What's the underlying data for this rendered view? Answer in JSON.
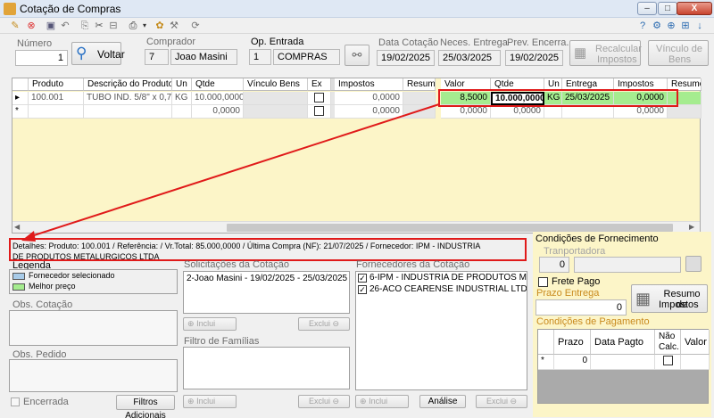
{
  "window": {
    "title": "Cotação de Compras",
    "minimize": "–",
    "maximize": "□",
    "close": "X"
  },
  "inner_controls": [
    "?",
    "⚙",
    "⊕",
    "⊞",
    "↓"
  ],
  "header": {
    "numero_label": "Número",
    "numero_value": "1",
    "voltar_label": "Voltar",
    "comprador_label": "Comprador",
    "comprador_code": "7",
    "comprador_name": "Joao Masini",
    "op_entrada_label": "Op. Entrada",
    "op_entrada_code": "1",
    "op_entrada_name": "COMPRAS",
    "data_cotacao_label": "Data Cotação",
    "data_cotacao_value": "19/02/2025",
    "neces_entrega_label": "Neces. Entrega",
    "neces_entrega_value": "25/03/2025",
    "prev_encerra_label": "Prev. Encerra.",
    "prev_encerra_value": "19/02/2025",
    "recalcular_label_1": "Recalcular",
    "recalcular_label_2": "Impostos",
    "vinculo_label_1": "Vínculo de",
    "vinculo_label_2": "Bens"
  },
  "grid": {
    "left_headers": [
      "Produto",
      "Descrição do Produto",
      "Un",
      "Qtde",
      "Vínculo Bens",
      "Ex",
      "Impostos",
      "Resumo"
    ],
    "right_headers": [
      "Valor",
      "Qtde",
      "Un",
      "Entrega",
      "Impostos",
      "Resumo"
    ],
    "row_markers": [
      "▸",
      "*"
    ],
    "rows": [
      {
        "produto": "100.001",
        "descricao": "TUBO IND. 5/8\" x 0,75M...",
        "un": "KG",
        "qtde": "10.000,0000",
        "impostos": "0,0000",
        "r_valor": "8,5000",
        "r_qtde": "10.000,0000",
        "r_un": "KG",
        "r_entrega": "25/03/2025",
        "r_impostos": "0,0000"
      },
      {
        "produto": "",
        "descricao": "",
        "un": "",
        "qtde": "0,0000",
        "impostos": "0,0000",
        "r_valor": "0,0000",
        "r_qtde": "0,0000",
        "r_un": "",
        "r_entrega": "",
        "r_impostos": "0,0000"
      }
    ]
  },
  "details": {
    "line1": "Detalhes:  Produto: 100.001 / Referência:  / Vr.Total: 85.000,0000 / Última Compra (NF): 21/07/2025 / Fornecedor: IPM - INDUSTRIA",
    "line2": "DE PRODUTOS METALURGICOS LTDA"
  },
  "legend": {
    "title": "Legenda",
    "items": [
      {
        "label": "Fornecedor selecionado",
        "color": "#a8cbe8"
      },
      {
        "label": "Melhor preço",
        "color": "#a5ec8f"
      }
    ]
  },
  "obs_cotacao_label": "Obs. Cotação",
  "obs_pedido_label": "Obs. Pedido",
  "encerrada_label": "Encerrada",
  "filtros_label": "Filtros Adicionais",
  "solicitacoes": {
    "label": "Solicitações da Cotação",
    "items": [
      "2-Joao Masini - 19/02/2025 - 25/03/2025"
    ],
    "inclui": "Inclui",
    "exclui": "Exclui"
  },
  "familias": {
    "label": "Filtro de Famílias",
    "inclui": "Inclui",
    "exclui": "Exclui"
  },
  "fornecedores": {
    "label": "Fornecedores da Cotação",
    "items": [
      "6-IPM - INDUSTRIA DE PRODUTOS ME",
      "26-ACO CEARENSE INDUSTRIAL LTDA"
    ],
    "inclui": "Inclui",
    "analise": "Análise",
    "exclui": "Exclui"
  },
  "fornecimento": {
    "title": "Condições de Fornecimento",
    "transportadora_label": "Tranportadora",
    "transportadora_code": "0",
    "frete_pago_label": "Frete Pago",
    "prazo_entrega_label": "Prazo Entrega",
    "prazo_entrega_value": "0",
    "resumo_label_1": "Resumo de",
    "resumo_label_2": "Impostos",
    "pagamento_title": "Condições de Pagamento",
    "pag_headers": [
      "Prazo",
      "Data Pagto",
      "Não Calc.",
      "Valor"
    ],
    "pag_row_marker": "*",
    "pag_row_prazo": "0"
  },
  "colors": {
    "highlight": "#e01a1a",
    "best_price": "#a5ec8f",
    "grid_bg": "#fcf5c8"
  }
}
